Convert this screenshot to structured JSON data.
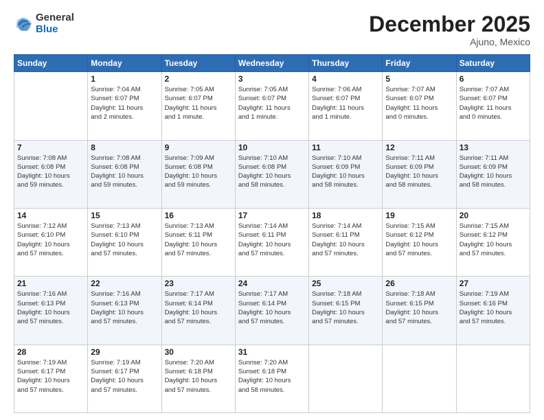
{
  "logo": {
    "general": "General",
    "blue": "Blue"
  },
  "header": {
    "month": "December 2025",
    "location": "Ajuno, Mexico"
  },
  "weekdays": [
    "Sunday",
    "Monday",
    "Tuesday",
    "Wednesday",
    "Thursday",
    "Friday",
    "Saturday"
  ],
  "weeks": [
    [
      {
        "day": "",
        "info": ""
      },
      {
        "day": "1",
        "info": "Sunrise: 7:04 AM\nSunset: 6:07 PM\nDaylight: 11 hours\nand 2 minutes."
      },
      {
        "day": "2",
        "info": "Sunrise: 7:05 AM\nSunset: 6:07 PM\nDaylight: 11 hours\nand 1 minute."
      },
      {
        "day": "3",
        "info": "Sunrise: 7:05 AM\nSunset: 6:07 PM\nDaylight: 11 hours\nand 1 minute."
      },
      {
        "day": "4",
        "info": "Sunrise: 7:06 AM\nSunset: 6:07 PM\nDaylight: 11 hours\nand 1 minute."
      },
      {
        "day": "5",
        "info": "Sunrise: 7:07 AM\nSunset: 6:07 PM\nDaylight: 11 hours\nand 0 minutes."
      },
      {
        "day": "6",
        "info": "Sunrise: 7:07 AM\nSunset: 6:07 PM\nDaylight: 11 hours\nand 0 minutes."
      }
    ],
    [
      {
        "day": "7",
        "info": "Sunrise: 7:08 AM\nSunset: 6:08 PM\nDaylight: 10 hours\nand 59 minutes."
      },
      {
        "day": "8",
        "info": "Sunrise: 7:08 AM\nSunset: 6:08 PM\nDaylight: 10 hours\nand 59 minutes."
      },
      {
        "day": "9",
        "info": "Sunrise: 7:09 AM\nSunset: 6:08 PM\nDaylight: 10 hours\nand 59 minutes."
      },
      {
        "day": "10",
        "info": "Sunrise: 7:10 AM\nSunset: 6:08 PM\nDaylight: 10 hours\nand 58 minutes."
      },
      {
        "day": "11",
        "info": "Sunrise: 7:10 AM\nSunset: 6:09 PM\nDaylight: 10 hours\nand 58 minutes."
      },
      {
        "day": "12",
        "info": "Sunrise: 7:11 AM\nSunset: 6:09 PM\nDaylight: 10 hours\nand 58 minutes."
      },
      {
        "day": "13",
        "info": "Sunrise: 7:11 AM\nSunset: 6:09 PM\nDaylight: 10 hours\nand 58 minutes."
      }
    ],
    [
      {
        "day": "14",
        "info": "Sunrise: 7:12 AM\nSunset: 6:10 PM\nDaylight: 10 hours\nand 57 minutes."
      },
      {
        "day": "15",
        "info": "Sunrise: 7:13 AM\nSunset: 6:10 PM\nDaylight: 10 hours\nand 57 minutes."
      },
      {
        "day": "16",
        "info": "Sunrise: 7:13 AM\nSunset: 6:11 PM\nDaylight: 10 hours\nand 57 minutes."
      },
      {
        "day": "17",
        "info": "Sunrise: 7:14 AM\nSunset: 6:11 PM\nDaylight: 10 hours\nand 57 minutes."
      },
      {
        "day": "18",
        "info": "Sunrise: 7:14 AM\nSunset: 6:11 PM\nDaylight: 10 hours\nand 57 minutes."
      },
      {
        "day": "19",
        "info": "Sunrise: 7:15 AM\nSunset: 6:12 PM\nDaylight: 10 hours\nand 57 minutes."
      },
      {
        "day": "20",
        "info": "Sunrise: 7:15 AM\nSunset: 6:12 PM\nDaylight: 10 hours\nand 57 minutes."
      }
    ],
    [
      {
        "day": "21",
        "info": "Sunrise: 7:16 AM\nSunset: 6:13 PM\nDaylight: 10 hours\nand 57 minutes."
      },
      {
        "day": "22",
        "info": "Sunrise: 7:16 AM\nSunset: 6:13 PM\nDaylight: 10 hours\nand 57 minutes."
      },
      {
        "day": "23",
        "info": "Sunrise: 7:17 AM\nSunset: 6:14 PM\nDaylight: 10 hours\nand 57 minutes."
      },
      {
        "day": "24",
        "info": "Sunrise: 7:17 AM\nSunset: 6:14 PM\nDaylight: 10 hours\nand 57 minutes."
      },
      {
        "day": "25",
        "info": "Sunrise: 7:18 AM\nSunset: 6:15 PM\nDaylight: 10 hours\nand 57 minutes."
      },
      {
        "day": "26",
        "info": "Sunrise: 7:18 AM\nSunset: 6:15 PM\nDaylight: 10 hours\nand 57 minutes."
      },
      {
        "day": "27",
        "info": "Sunrise: 7:19 AM\nSunset: 6:16 PM\nDaylight: 10 hours\nand 57 minutes."
      }
    ],
    [
      {
        "day": "28",
        "info": "Sunrise: 7:19 AM\nSunset: 6:17 PM\nDaylight: 10 hours\nand 57 minutes."
      },
      {
        "day": "29",
        "info": "Sunrise: 7:19 AM\nSunset: 6:17 PM\nDaylight: 10 hours\nand 57 minutes."
      },
      {
        "day": "30",
        "info": "Sunrise: 7:20 AM\nSunset: 6:18 PM\nDaylight: 10 hours\nand 57 minutes."
      },
      {
        "day": "31",
        "info": "Sunrise: 7:20 AM\nSunset: 6:18 PM\nDaylight: 10 hours\nand 58 minutes."
      },
      {
        "day": "",
        "info": ""
      },
      {
        "day": "",
        "info": ""
      },
      {
        "day": "",
        "info": ""
      }
    ]
  ]
}
